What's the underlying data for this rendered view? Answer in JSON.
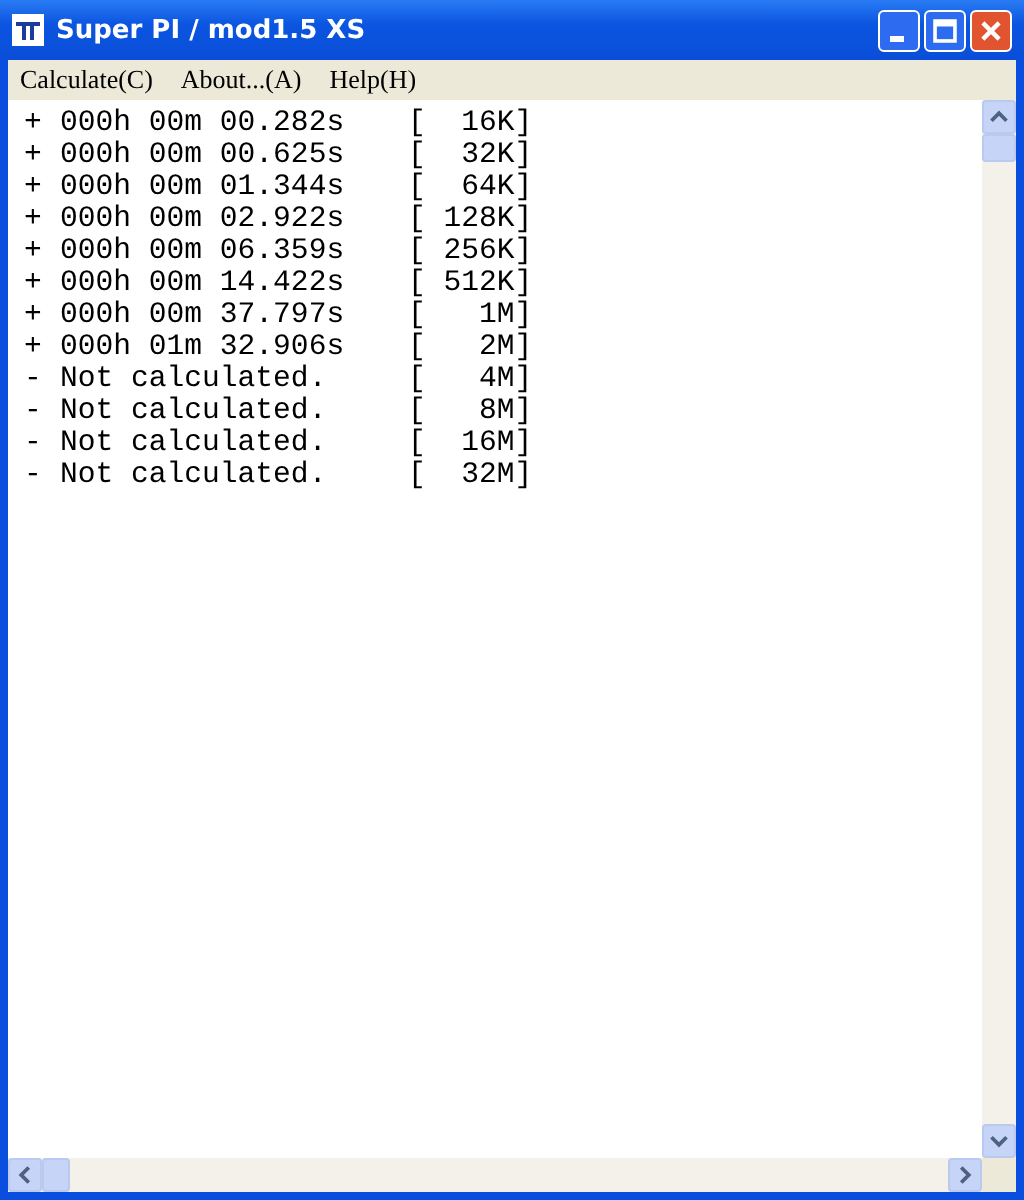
{
  "window": {
    "title": "Super PI / mod1.5 XS"
  },
  "menu": [
    {
      "label": "Calculate(C)"
    },
    {
      "label": "About...(A)"
    },
    {
      "label": "Help(H)"
    }
  ],
  "results": [
    {
      "sign": "+",
      "result": "000h 00m 00.282s",
      "size": "[  16K]"
    },
    {
      "sign": "+",
      "result": "000h 00m 00.625s",
      "size": "[  32K]"
    },
    {
      "sign": "+",
      "result": "000h 00m 01.344s",
      "size": "[  64K]"
    },
    {
      "sign": "+",
      "result": "000h 00m 02.922s",
      "size": "[ 128K]"
    },
    {
      "sign": "+",
      "result": "000h 00m 06.359s",
      "size": "[ 256K]"
    },
    {
      "sign": "+",
      "result": "000h 00m 14.422s",
      "size": "[ 512K]"
    },
    {
      "sign": "+",
      "result": "000h 00m 37.797s",
      "size": "[   1M]"
    },
    {
      "sign": "+",
      "result": "000h 01m 32.906s",
      "size": "[   2M]"
    },
    {
      "sign": "-",
      "result": "Not calculated.",
      "size": "[   4M]"
    },
    {
      "sign": "-",
      "result": "Not calculated.",
      "size": "[   8M]"
    },
    {
      "sign": "-",
      "result": "Not calculated.",
      "size": "[  16M]"
    },
    {
      "sign": "-",
      "result": "Not calculated.",
      "size": "[  32M]"
    }
  ]
}
